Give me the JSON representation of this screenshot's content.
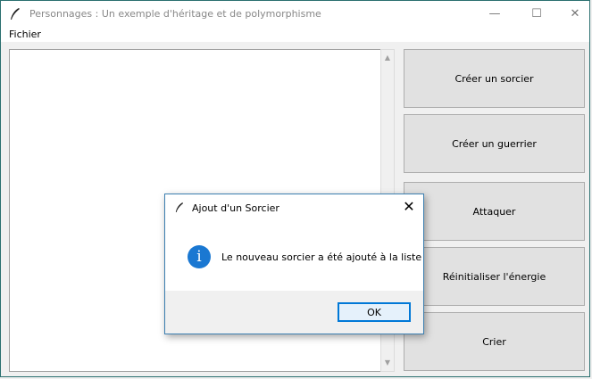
{
  "window": {
    "title": "Personnages : Un exemple d'héritage et de polymorphisme",
    "controls": {
      "minimize": "—",
      "maximize": "☐",
      "close": "✕"
    }
  },
  "menubar": {
    "items": [
      {
        "label": "Fichier"
      }
    ]
  },
  "buttons": [
    {
      "label": "Créer un sorcier"
    },
    {
      "label": "Créer un guerrier"
    },
    {
      "label": "Attaquer"
    },
    {
      "label": "Réinitialiser l'énergie"
    },
    {
      "label": "Crier"
    }
  ],
  "dialog": {
    "title": "Ajout d'un Sorcier",
    "close": "✕",
    "icon": "info-icon",
    "icon_glyph": "i",
    "message": "Le nouveau sorcier a été ajouté à la liste",
    "ok_label": "OK"
  },
  "scrollbar": {
    "up": "▲",
    "down": "▼"
  },
  "colors": {
    "accent": "#0078d7",
    "info_icon": "#1a78d2",
    "button_bg": "#e1e1e1"
  }
}
